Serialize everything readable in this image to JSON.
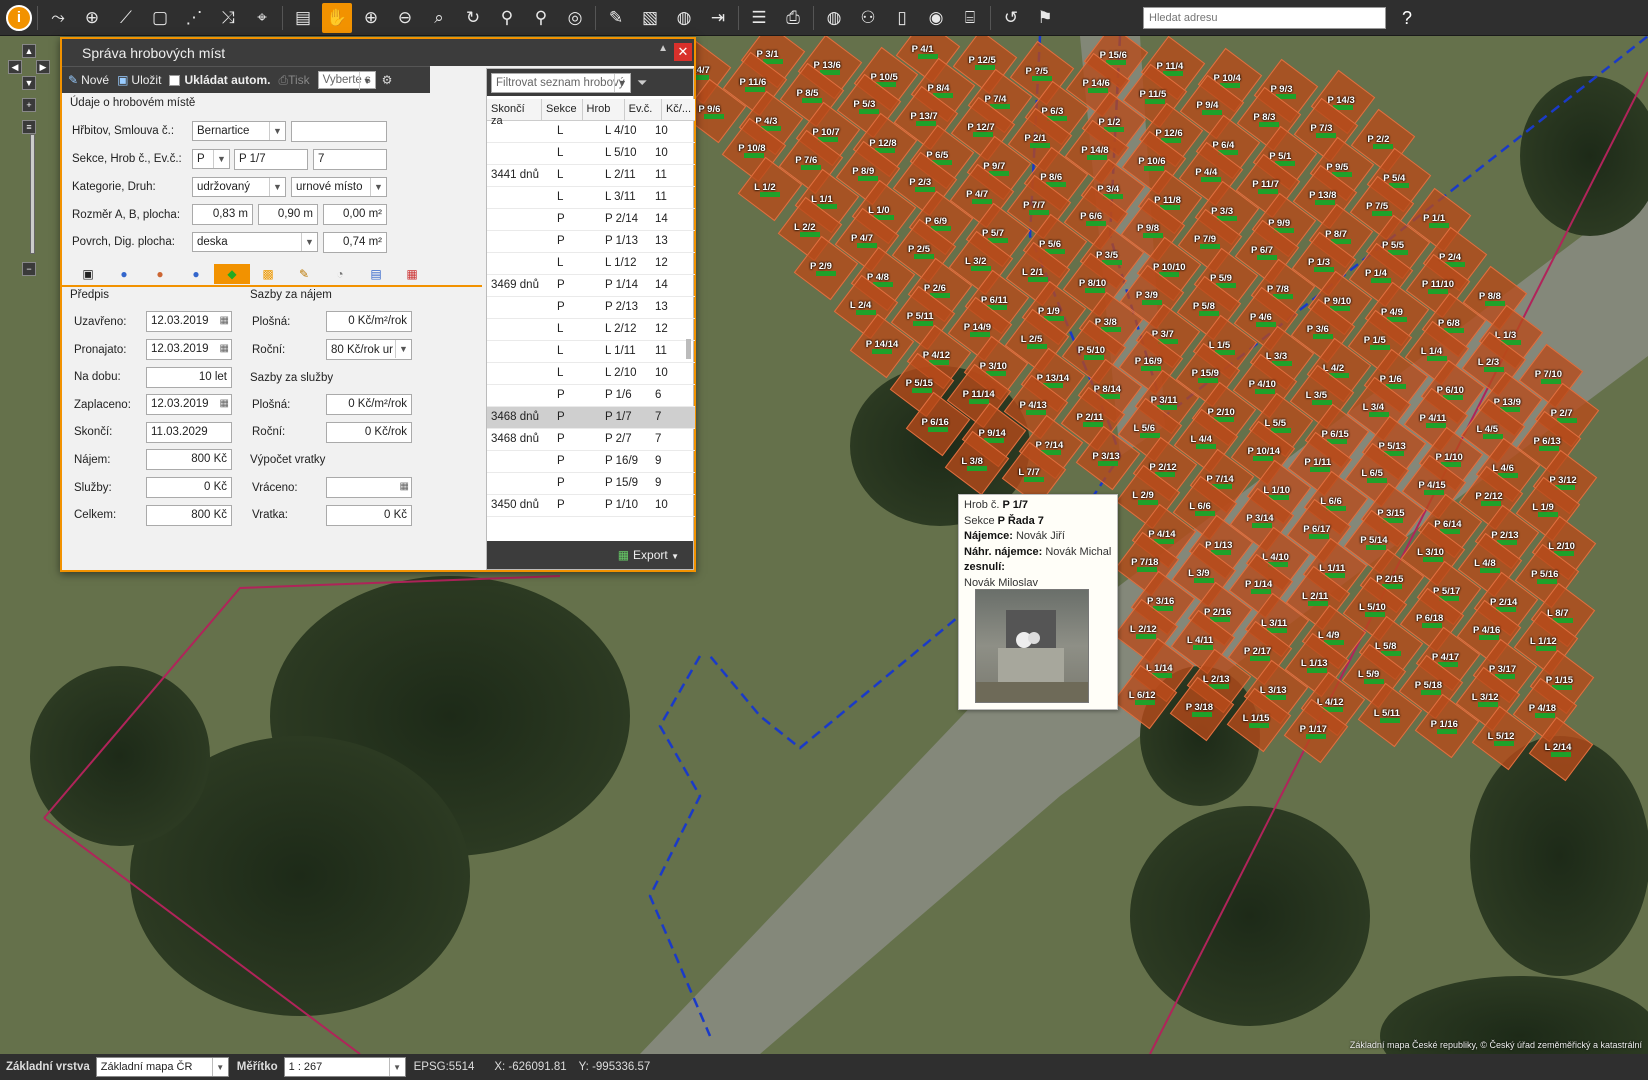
{
  "toolbar": {
    "search_placeholder": "Hledat adresu",
    "icons": [
      "info-icon",
      "measure-line-icon",
      "add-point-icon",
      "add-line-icon",
      "add-polygon-icon",
      "snap-icon",
      "route-icon",
      "binoculars-icon",
      "calculator-icon",
      "pan-hand-icon",
      "zoom-in-icon",
      "zoom-out-icon",
      "zoom-area-icon",
      "refresh-icon",
      "pin-icon",
      "marker-icon",
      "target-icon",
      "ruler-icon",
      "area-measure-icon",
      "globe-icon",
      "export-icon",
      "list-icon",
      "print-icon",
      "globe2-icon",
      "share-icon",
      "clipboard-icon",
      "cadastre-icon",
      "bed-icon",
      "back-icon",
      "bookmark-icon",
      "help-icon"
    ]
  },
  "dialog": {
    "title": "Správa hrobových míst",
    "tool": {
      "new": "Nové",
      "save": "Uložit",
      "autosave": "Ukládat autom.",
      "print": "Tisk",
      "print_select": "Vyberte s"
    },
    "section_title": "Údaje o hrobovém místě",
    "fields": {
      "cemetery_label": "Hřbitov, Smlouva č.:",
      "cemetery": "Bernartice",
      "contract": "",
      "section_label": "Sekce, Hrob č., Ev.č.:",
      "section": "P",
      "grave": "P 1/7",
      "evc": "7",
      "category_label": "Kategorie, Druh:",
      "category": "udržovaný",
      "kind": "urnové místo",
      "size_label": "Rozměr A, B, plocha:",
      "a": "0,83 m",
      "b": "0,90 m",
      "area": "0,00 m²",
      "surface_label": "Povrch, Dig. plocha:",
      "surface": "deska",
      "dig_area": "0,74 m²"
    },
    "predpis": {
      "title": "Předpis",
      "uzavreno_label": "Uzavřeno:",
      "uzavreno": "12.03.2019",
      "pronajato_label": "Pronajato:",
      "pronajato": "12.03.2019",
      "nadobu_label": "Na dobu:",
      "nadobu": "10 let",
      "zaplaceno_label": "Zaplaceno:",
      "zaplaceno": "12.03.2019",
      "skonci_label": "Skončí:",
      "skonci": "11.03.2029",
      "najem_label": "Nájem:",
      "najem": "800 Kč",
      "sluzby_label": "Služby:",
      "sluzby": "0 Kč",
      "celkem_label": "Celkem:",
      "celkem": "800 Kč"
    },
    "sazby_najem": {
      "title": "Sazby za nájem",
      "plosna_label": "Plošná:",
      "plosna": "0 Kč/m²/rok",
      "rocni_label": "Roční:",
      "rocni": "80 Kč/rok ur"
    },
    "sazby_sluzby": {
      "title": "Sazby za služby",
      "plosna_label": "Plošná:",
      "plosna": "0 Kč/m²/rok",
      "rocni_label": "Roční:",
      "rocni": "0 Kč/rok"
    },
    "vratky": {
      "title": "Výpočet vratky",
      "vraceno_label": "Vráceno:",
      "vraceno": "",
      "vratka_label": "Vratka:",
      "vratka": "0 Kč"
    },
    "filter_placeholder": "Filtrovat seznam hrobový",
    "table": {
      "headers": [
        "Skončí za",
        "Sekce",
        "Hrob",
        "Ev.č.",
        "Kč/..."
      ],
      "rows": [
        [
          "",
          "L",
          "L 4/10",
          "10"
        ],
        [
          "",
          "L",
          "L 5/10",
          "10"
        ],
        [
          "3441 dnů",
          "L",
          "L 2/11",
          "11"
        ],
        [
          "",
          "L",
          "L 3/11",
          "11"
        ],
        [
          "",
          "P",
          "P 2/14",
          "14"
        ],
        [
          "",
          "P",
          "P 1/13",
          "13"
        ],
        [
          "",
          "L",
          "L 1/12",
          "12"
        ],
        [
          "3469 dnů",
          "P",
          "P 1/14",
          "14"
        ],
        [
          "",
          "P",
          "P 2/13",
          "13"
        ],
        [
          "",
          "L",
          "L 2/12",
          "12"
        ],
        [
          "",
          "L",
          "L 1/11",
          "11"
        ],
        [
          "",
          "L",
          "L 2/10",
          "10"
        ],
        [
          "",
          "P",
          "P 1/6",
          "6"
        ],
        [
          "3468 dnů",
          "P",
          "P 1/7",
          "7"
        ],
        [
          "3468 dnů",
          "P",
          "P 2/7",
          "7"
        ],
        [
          "",
          "P",
          "P 16/9",
          "9"
        ],
        [
          "",
          "P",
          "P 15/9",
          "9"
        ],
        [
          "3450 dnů",
          "P",
          "P 1/10",
          "10"
        ]
      ]
    },
    "export": "Export"
  },
  "tooltip": {
    "l1a": "Hrob č. ",
    "l1b": "P 1/7",
    "l2a": "Sekce ",
    "l2b": "P",
    "l2c": " Řada 7",
    "l3a": "Nájemce:",
    "l3b": " Novák Jiří",
    "l4a": "Náhr. nájemce:",
    "l4b": " Novák Michal",
    "l5a": "zesnulí:",
    "l6": "Novák Miloslav"
  },
  "graves": [
    "P 15/6",
    "P 11/4",
    "P 10/4",
    "P 9/3",
    "P 14/3",
    "P 4/1",
    "P 12/5",
    "P ?/5",
    "P 14/6",
    "P 11/5",
    "P 9/4",
    "P 8/3",
    "P 7/3",
    "P 2/2",
    "P 3/1",
    "P 13/6",
    "P 10/5",
    "P 8/4",
    "P 7/4",
    "P 6/3",
    "P 1/2",
    "P 12/6",
    "P 6/4",
    "P 5/1",
    "P 9/5",
    "P 5/4",
    "P 14/7",
    "P 11/6",
    "P 8/5",
    "P 5/3",
    "P 13/7",
    "P 12/7",
    "P 2/1",
    "P 14/8",
    "P 10/6",
    "P 4/4",
    "P 11/7",
    "P 13/8",
    "P 7/5",
    "P 1/1",
    "P 9/6",
    "P 4/3",
    "P 10/7",
    "P 12/8",
    "P 6/5",
    "P 9/7",
    "P 8/6",
    "P 3/4",
    "P 11/8",
    "P 3/3",
    "P 9/9",
    "P 8/7",
    "P 5/5",
    "P 2/4",
    "P 10/8",
    "P 7/6",
    "P 8/9",
    "P 2/3",
    "P 4/7",
    "P 7/7",
    "P 6/6",
    "P 9/8",
    "P 7/9",
    "P 6/7",
    "P 1/3",
    "P 1/4",
    "P 11/10",
    "P 8/8",
    "L 1/2",
    "L 1/1",
    "L 1/0",
    "P 6/9",
    "P 5/7",
    "P 5/6",
    "P 3/5",
    "P 10/10",
    "P 5/9",
    "P 7/8",
    "P 9/10",
    "P 4/9",
    "P 6/8",
    "L 1/3",
    "L 2/2",
    "P 4/7",
    "P 2/5",
    "L 3/2",
    "L 2/1",
    "P 8/10",
    "P 3/9",
    "P 5/8",
    "P 4/6",
    "P 3/6",
    "P 1/5",
    "L 1/4",
    "L 2/3",
    "P 7/10",
    "P 2/9",
    "P 4/8",
    "P 2/6",
    "P 6/11",
    "P 1/9",
    "P 3/8",
    "P 3/7",
    "L 1/5",
    "L 3/3",
    "L 4/2",
    "P 1/6",
    "P 6/10",
    "P 13/9",
    "P 2/7",
    "L 2/4",
    "P 5/11",
    "P 14/9",
    "L 2/5",
    "P 5/10",
    "P 16/9",
    "P 15/9",
    "P 4/10",
    "L 3/5",
    "L 3/4",
    "P 4/11",
    "L 4/5",
    "P 6/13",
    "P 14/14",
    "P 4/12",
    "P 3/10",
    "P 13/14",
    "P 8/14",
    "P 3/11",
    "P 2/10",
    "L 5/5",
    "P 6/15",
    "P 5/13",
    "P 1/10",
    "L 4/6",
    "P 3/12",
    "P 5/15",
    "P 11/14",
    "P 4/13",
    "P 2/11",
    "L 5/6",
    "L 4/4",
    "P 10/14",
    "P 1/11",
    "L 6/5",
    "P 4/15",
    "P 2/12",
    "L 1/9",
    "P 6/16",
    "P 9/14",
    "P ?/14",
    "P 3/13",
    "P 2/12",
    "P 7/14",
    "L 1/10",
    "L 6/6",
    "P 3/15",
    "P 6/14",
    "P 2/13",
    "L 2/10",
    "L 3/8",
    "L 7/7",
    "L 2/9",
    "L 6/6",
    "P 3/14",
    "P 6/17",
    "P 5/14",
    "L 3/10",
    "L 4/8",
    "P 5/16",
    "P 4/14",
    "P 1/13",
    "L 4/10",
    "L 1/11",
    "P 2/15",
    "P 5/17",
    "P 2/14",
    "L 8/7",
    "P 7/18",
    "L 3/9",
    "P 1/14",
    "L 2/11",
    "L 5/10",
    "P 6/18",
    "P 4/16",
    "L 1/12",
    "P 3/16",
    "P 2/16",
    "L 3/11",
    "L 4/9",
    "L 5/8",
    "P 4/17",
    "P 3/17",
    "P 1/15",
    "L 2/12",
    "L 4/11",
    "P 2/17",
    "L 1/13",
    "L 5/9",
    "P 5/18",
    "L 3/12",
    "P 4/18",
    "L 1/14",
    "L 2/13",
    "L 3/13",
    "L 4/12",
    "L 5/11",
    "P 1/16",
    "L 5/12",
    "L 2/14",
    "L 6/12",
    "P 3/18",
    "L 1/15",
    "P 1/17"
  ],
  "status": {
    "layer_label": "Základní vrstva",
    "layer": "Základní mapa ČR",
    "scale_label": "Měřítko",
    "scale": "1 : 267",
    "epsg": "EPSG:5514",
    "x": "X: -626091.81",
    "y": "Y: -995336.57",
    "copyright": "Základní mapa České republiky, © Český úřad zeměměřický a katastrální"
  }
}
